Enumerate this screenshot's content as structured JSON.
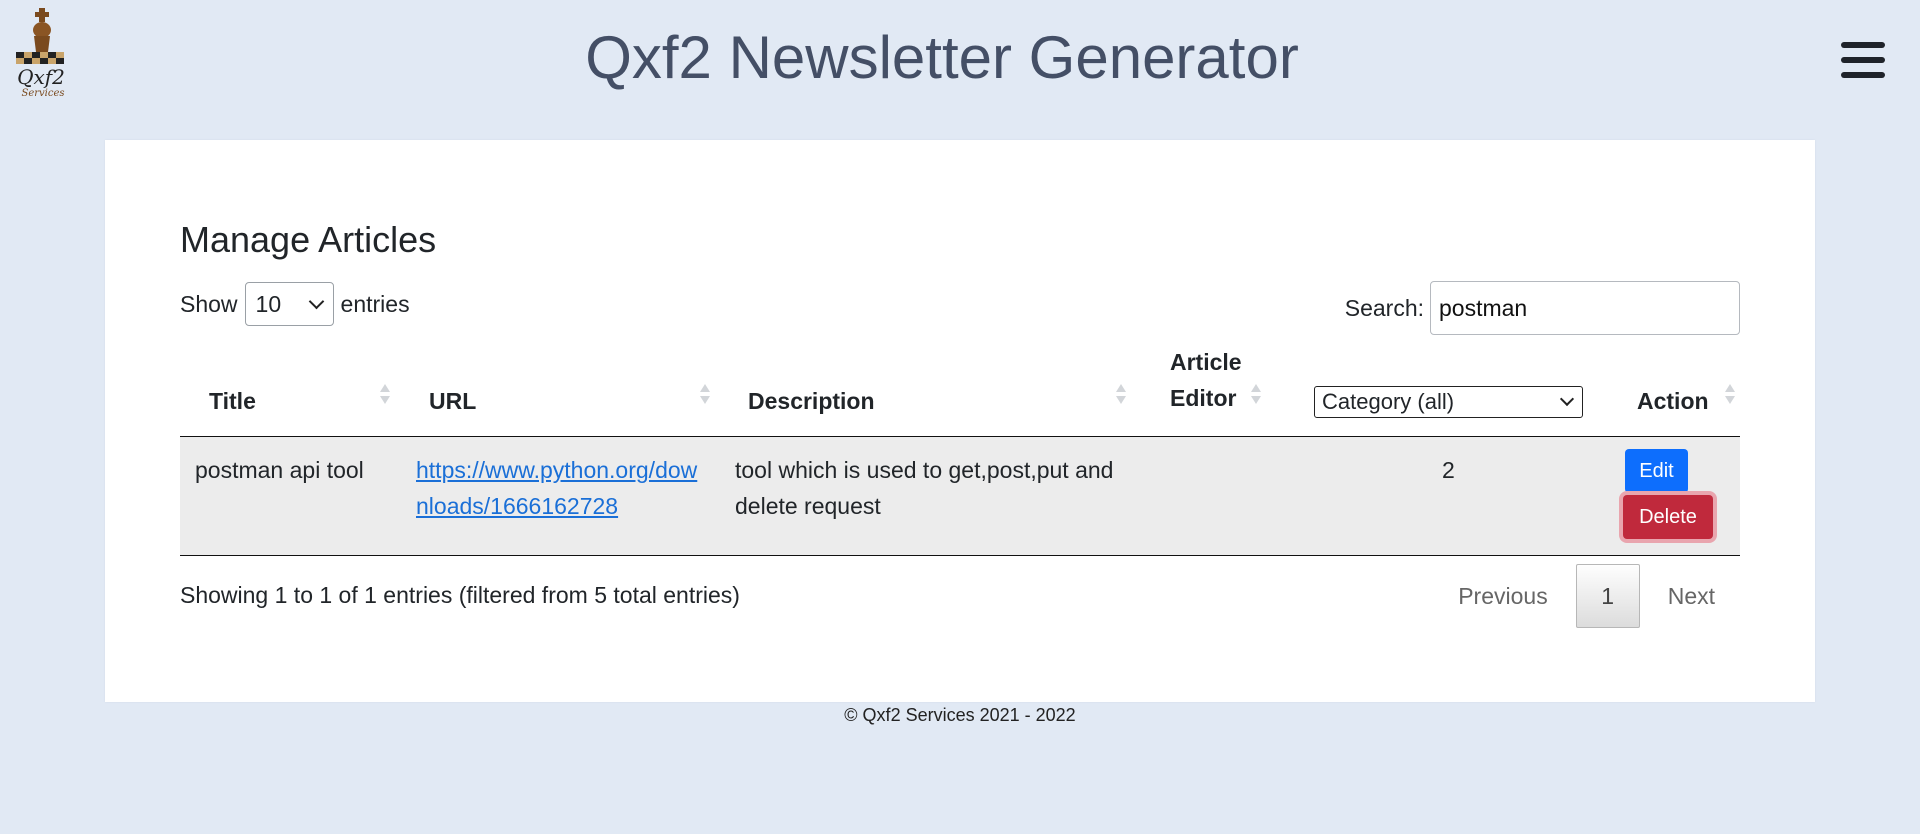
{
  "header": {
    "title": "Qxf2 Newsletter Generator",
    "logo_text": "Qxf2",
    "logo_subtext": "Services"
  },
  "page": {
    "heading": "Manage Articles"
  },
  "length_control": {
    "prefix": "Show",
    "selected": "10",
    "suffix": "entries"
  },
  "search": {
    "label": "Search:",
    "value": "postman"
  },
  "table": {
    "columns": {
      "title": "Title",
      "url": "URL",
      "description": "Description",
      "article_editor_line1": "Article",
      "article_editor_line2": "Editor",
      "category_filter": "Category (all)",
      "action": "Action"
    },
    "rows": [
      {
        "title": "postman api tool",
        "url": "https://www.python.org/downloads/1666162728",
        "description": "tool which is used to get,post,put and delete request",
        "article_editor": "",
        "category": "2",
        "edit_label": "Edit",
        "delete_label": "Delete"
      }
    ]
  },
  "info": {
    "text": "Showing 1 to 1 of 1 entries (filtered from 5 total entries)"
  },
  "pagination": {
    "previous": "Previous",
    "current_page": "1",
    "next": "Next"
  },
  "footer": {
    "copyright": "© Qxf2 Services 2021 - 2022"
  },
  "colors": {
    "background": "#e1e9f4",
    "title": "#444f66",
    "edit_button": "#0d6efd",
    "delete_button": "#c0293c",
    "link": "#1a6fd7"
  },
  "icons": {
    "menu": "hamburger-menu-icon",
    "logo": "chess-king-logo"
  }
}
